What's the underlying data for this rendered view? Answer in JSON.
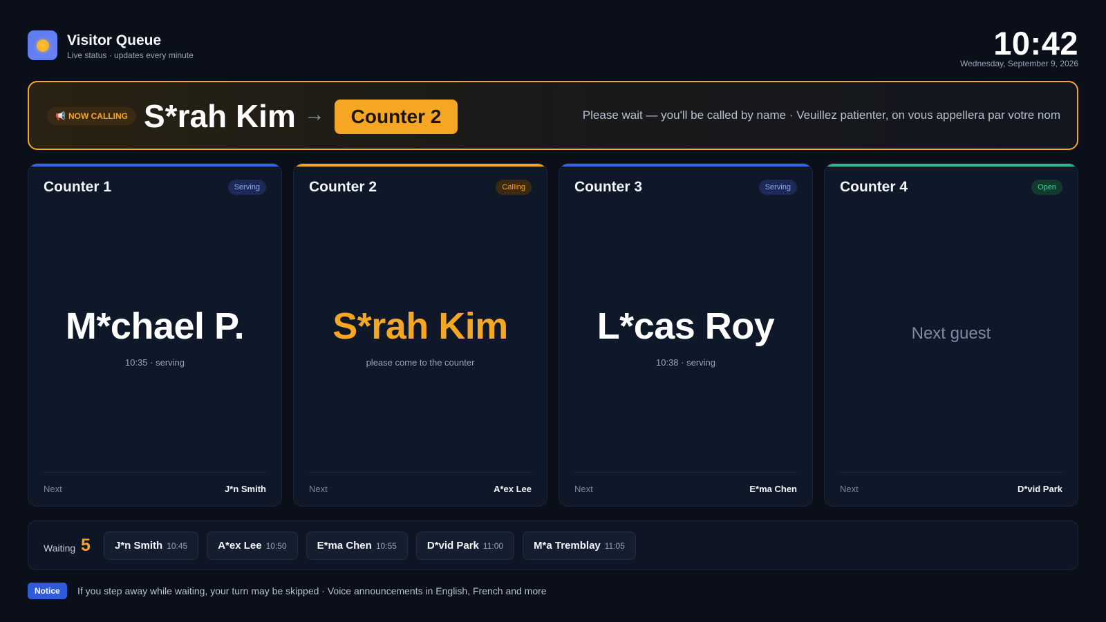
{
  "header": {
    "title": "Visitor Queue",
    "subtitle": "Live status · updates every minute",
    "clock": "10:42",
    "date": "Wednesday, September 9, 2026"
  },
  "banner": {
    "tag": "NOW CALLING",
    "tag_icon": "📢",
    "name": "S*rah Kim",
    "arrow": "→",
    "counter": "Counter 2",
    "message": "Please wait — you'll be called by name · Veuillez patienter, on vous appellera par votre nom"
  },
  "counters": [
    {
      "title": "Counter 1",
      "status": "Serving",
      "name": "M*chael P.",
      "sub": "10:35 · serving",
      "next_label": "Next",
      "next": "J*n Smith",
      "accent": "#3b63e8"
    },
    {
      "title": "Counter 2",
      "status": "Calling",
      "name": "S*rah Kim",
      "sub": "please come to the counter",
      "next_label": "Next",
      "next": "A*ex Lee",
      "accent": "#f5a623"
    },
    {
      "title": "Counter 3",
      "status": "Serving",
      "name": "L*cas Roy",
      "sub": "10:38 · serving",
      "next_label": "Next",
      "next": "E*ma Chen",
      "accent": "#3b63e8"
    },
    {
      "title": "Counter 4",
      "status": "Open",
      "empty": "Next guest",
      "next_label": "Next",
      "next": "D*vid Park",
      "accent": "#2fb98a"
    }
  ],
  "waiting": {
    "label": "Waiting",
    "count": "5",
    "items": [
      {
        "name": "J*n Smith",
        "time": "10:45"
      },
      {
        "name": "A*ex Lee",
        "time": "10:50"
      },
      {
        "name": "E*ma Chen",
        "time": "10:55"
      },
      {
        "name": "D*vid Park",
        "time": "11:00"
      },
      {
        "name": "M*a Tremblay",
        "time": "11:05"
      }
    ]
  },
  "notice": {
    "badge": "Notice",
    "text": "If you step away while waiting, your turn may be skipped · Voice announcements in English, French and more"
  },
  "colors": {
    "accent_amber": "#f5a623",
    "serving_blue": "#3b63e8",
    "open_green": "#2fb98a",
    "background": "#0a0f1a"
  }
}
